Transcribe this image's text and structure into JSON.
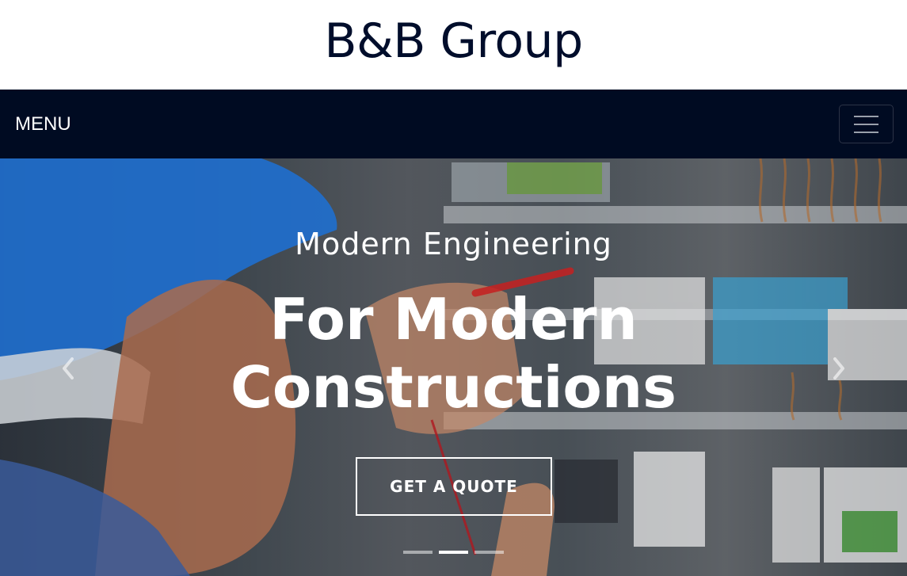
{
  "header": {
    "brand_title": "B&B Group"
  },
  "navbar": {
    "menu_label": "MENU",
    "toggler_icon": "hamburger-icon"
  },
  "hero": {
    "subtitle": "Modern Engineering",
    "headline_line1": "For Modern",
    "headline_line2": "Constructions",
    "cta_label": "GET A QUOTE",
    "prev_icon": "chevron-left-icon",
    "next_icon": "chevron-right-icon",
    "slides_total": 3,
    "active_slide": 2
  },
  "colors": {
    "navbar_bg": "#000b22",
    "brand_text": "#000d2b",
    "hero_text": "#ffffff"
  }
}
